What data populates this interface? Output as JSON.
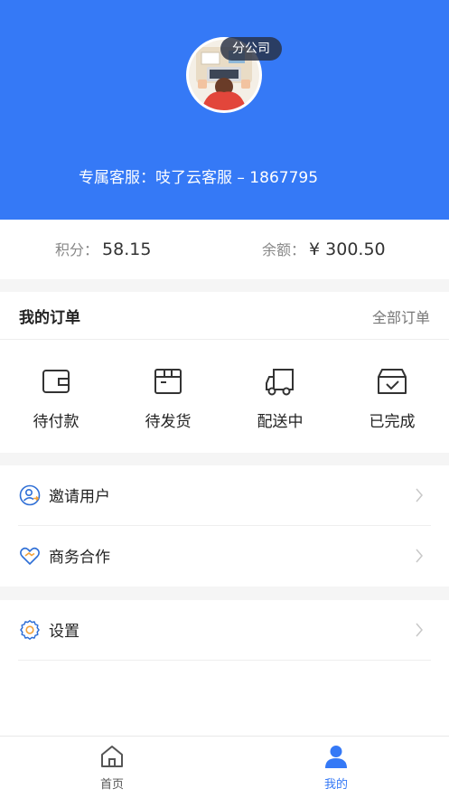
{
  "header": {
    "branch_badge": "分公司",
    "service_text": "专属客服：吱了云客服 – 1867795",
    "bg_color": "#3579f6"
  },
  "stats": {
    "points_label": "积分：",
    "points_value": "58.15",
    "balance_label": "余额：",
    "balance_value": "¥ 300.50"
  },
  "orders": {
    "title": "我的订单",
    "all_link": "全部订单",
    "statuses": [
      {
        "label": "待付款",
        "icon": "wallet-icon"
      },
      {
        "label": "待发货",
        "icon": "package-icon"
      },
      {
        "label": "配送中",
        "icon": "truck-icon"
      },
      {
        "label": "已完成",
        "icon": "completed-box-icon"
      }
    ]
  },
  "menu": {
    "items": [
      {
        "label": "邀请用户",
        "icon": "invite-user-icon"
      },
      {
        "label": "商务合作",
        "icon": "handshake-heart-icon"
      },
      {
        "label": "设置",
        "icon": "settings-gear-icon"
      }
    ]
  },
  "tabbar": {
    "tabs": [
      {
        "label": "首页",
        "icon": "home-icon",
        "active": false
      },
      {
        "label": "我的",
        "icon": "user-icon",
        "active": true
      }
    ],
    "active_color": "#3579f6"
  }
}
